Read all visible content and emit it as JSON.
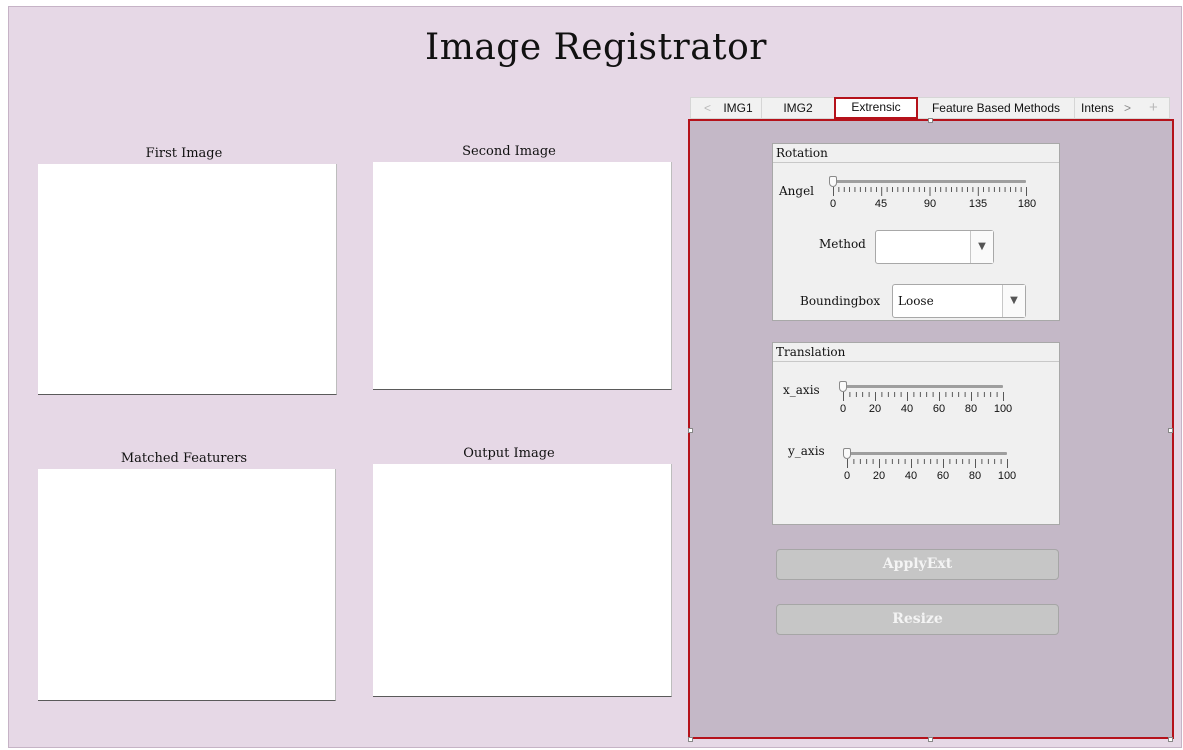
{
  "app": {
    "title": "Image Registrator"
  },
  "images": {
    "first_label": "First Image",
    "second_label": "Second Image",
    "matched_label": "Matched Featurers",
    "output_label": "Output Image"
  },
  "tabs": {
    "items": [
      "IMG1",
      "IMG2",
      "Extrensic",
      "Feature Based Methods",
      "Intens"
    ],
    "active": "Extrensic",
    "prev_arrow": "<",
    "next_arrow": ">",
    "add": "+"
  },
  "rotation": {
    "title": "Rotation",
    "angle_label": "Angel",
    "angle_value": 0,
    "angle_ticks": [
      "0",
      "45",
      "90",
      "135",
      "180"
    ],
    "method_label": "Method",
    "method_value": "",
    "bbox_label": "Boundingbox",
    "bbox_value": "Loose",
    "dropdown_arrow": "▼"
  },
  "translation": {
    "title": "Translation",
    "x_label": "x_axis",
    "x_value": 0,
    "y_label": "y_axis",
    "y_value": 0,
    "ticks": [
      "0",
      "20",
      "40",
      "60",
      "80",
      "100"
    ]
  },
  "buttons": {
    "apply": "ApplyExt",
    "resize": "Resize"
  },
  "colors": {
    "background": "#e6d8e6",
    "panel": "#c4b8c7",
    "selection": "#b5121b"
  }
}
